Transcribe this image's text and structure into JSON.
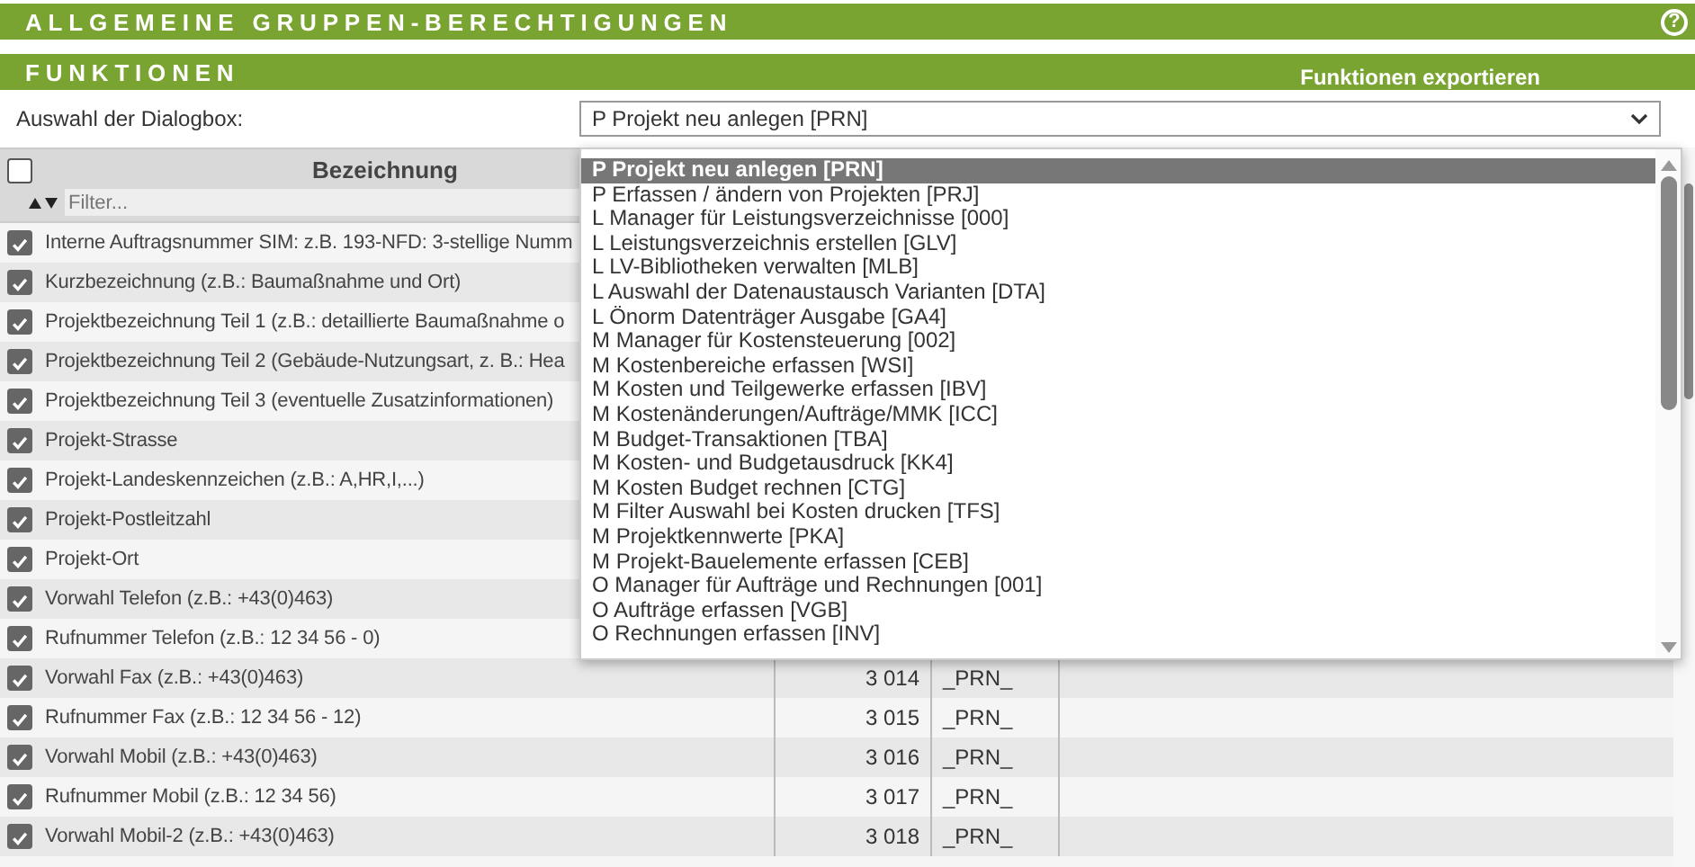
{
  "header": {
    "title": "ALLGEMEINE GRUPPEN-BERECHTIGUNGEN",
    "help": "?"
  },
  "section": {
    "title": "FUNKTIONEN",
    "export_link": "Funktionen exportieren"
  },
  "dialog_select": {
    "label": "Auswahl der Dialogbox:",
    "value": "P Projekt neu anlegen [PRN]",
    "expanded": true,
    "options": [
      {
        "label": "P Projekt neu anlegen [PRN]",
        "selected": true
      },
      {
        "label": "P Erfassen / ändern von Projekten [PRJ]",
        "selected": false
      },
      {
        "label": "L Manager für Leistungsverzeichnisse [000]",
        "selected": false
      },
      {
        "label": "L Leistungsverzeichnis erstellen [GLV]",
        "selected": false
      },
      {
        "label": "L LV-Bibliotheken verwalten [MLB]",
        "selected": false
      },
      {
        "label": "L Auswahl der Datenaustausch Varianten [DTA]",
        "selected": false
      },
      {
        "label": "L Önorm Datenträger Ausgabe [GA4]",
        "selected": false
      },
      {
        "label": "M Manager für Kostensteuerung [002]",
        "selected": false
      },
      {
        "label": "M Kostenbereiche erfassen [WSI]",
        "selected": false
      },
      {
        "label": "M Kosten und Teilgewerke erfassen [IBV]",
        "selected": false
      },
      {
        "label": "M Kostenänderungen/Aufträge/MMK [ICC]",
        "selected": false
      },
      {
        "label": "M Budget-Transaktionen [TBA]",
        "selected": false
      },
      {
        "label": "M Kosten- und Budgetausdruck [KK4]",
        "selected": false
      },
      {
        "label": "M Kosten Budget rechnen [CTG]",
        "selected": false
      },
      {
        "label": "M Filter Auswahl bei Kosten drucken [TFS]",
        "selected": false
      },
      {
        "label": "M Projektkennwerte [PKA]",
        "selected": false
      },
      {
        "label": "M Projekt-Bauelemente erfassen [CEB]",
        "selected": false
      },
      {
        "label": "O Manager für Aufträge und Rechnungen [001]",
        "selected": false
      },
      {
        "label": "O Aufträge erfassen [VGB]",
        "selected": false
      },
      {
        "label": "O Rechnungen erfassen [INV]",
        "selected": false
      }
    ]
  },
  "table": {
    "select_all_checked": false,
    "column_header": "Bezeichnung",
    "filter": {
      "placeholder": "Filter..."
    },
    "rows": [
      {
        "label": "Interne Auftragsnummer SIM: z.B. 193-NFD: 3-stellige Numm",
        "checked": true
      },
      {
        "label": "Kurzbezeichnung (z.B.: Baumaßnahme und Ort)",
        "checked": true
      },
      {
        "label": "Projektbezeichnung Teil 1 (z.B.: detaillierte Baumaßnahme o",
        "checked": true
      },
      {
        "label": "Projektbezeichnung Teil 2 (Gebäude-Nutzungsart, z. B.: Hea",
        "checked": true
      },
      {
        "label": "Projektbezeichnung Teil 3 (eventuelle Zusatzinformationen)",
        "checked": true
      },
      {
        "label": "Projekt-Strasse",
        "checked": true
      },
      {
        "label": "Projekt-Landeskennzeichen (z.B.: A,HR,I,...)",
        "checked": true
      },
      {
        "label": "Projekt-Postleitzahl",
        "checked": true
      },
      {
        "label": "Projekt-Ort",
        "checked": true
      },
      {
        "label": "Vorwahl Telefon (z.B.: +43(0)463)",
        "checked": true
      },
      {
        "label": "Rufnummer Telefon (z.B.: 12 34 56 - 0)",
        "checked": true
      },
      {
        "label": "Vorwahl Fax (z.B.: +43(0)463)",
        "checked": true,
        "number": "3 014",
        "code": "_PRN_"
      },
      {
        "label": "Rufnummer Fax (z.B.: 12 34 56 - 12)",
        "checked": true,
        "number": "3 015",
        "code": "_PRN_"
      },
      {
        "label": "Vorwahl Mobil (z.B.: +43(0)463)",
        "checked": true,
        "number": "3 016",
        "code": "_PRN_"
      },
      {
        "label": "Rufnummer Mobil (z.B.: 12 34 56)",
        "checked": true,
        "number": "3 017",
        "code": "_PRN_"
      },
      {
        "label": "Vorwahl Mobil-2 (z.B.: +43(0)463)",
        "checked": true,
        "number": "3 018",
        "code": "_PRN_"
      }
    ]
  }
}
